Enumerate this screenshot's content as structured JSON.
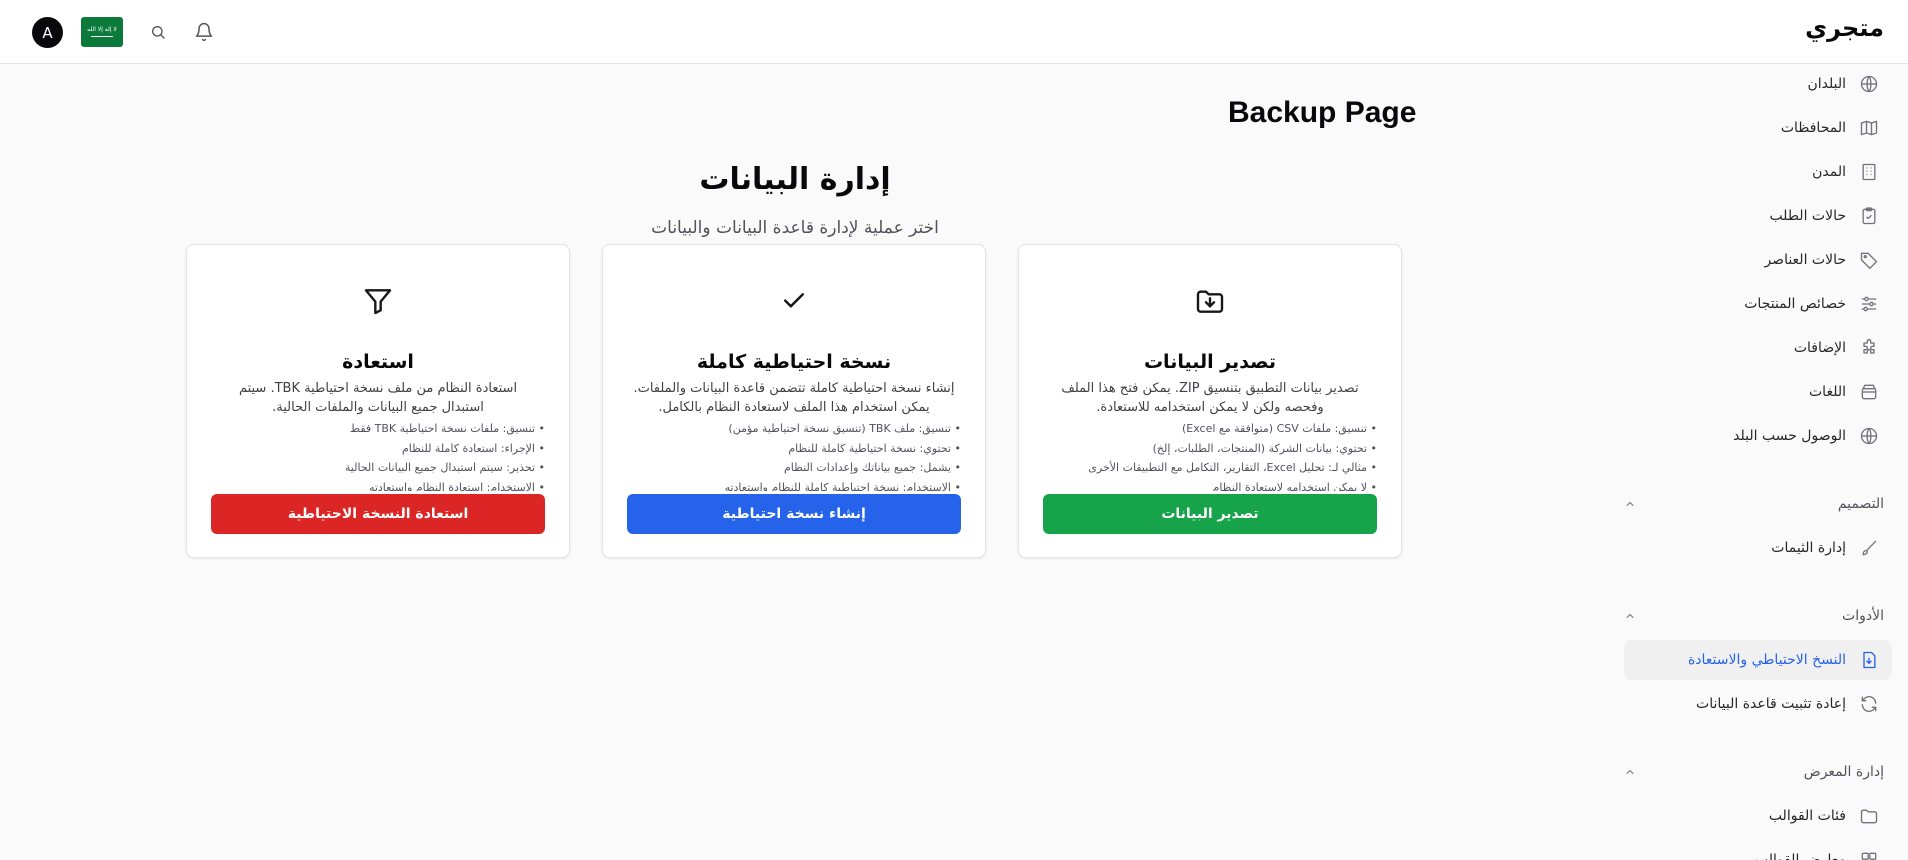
{
  "header": {
    "brand": "متجري",
    "avatar_initial": "A",
    "flag_script": "لا إله إلا الله",
    "icons": [
      "bell-icon",
      "search-icon"
    ]
  },
  "page": {
    "title": "Backup Page",
    "section_title": "إدارة البيانات",
    "section_subtitle": "اختر عملية لإدارة قاعدة البيانات والبيانات"
  },
  "cards": [
    {
      "icon": "folder-download-icon",
      "title": "تصدير البيانات",
      "description": "تصدير بيانات التطبيق بتنسيق ZIP. يمكن فتح هذا الملف وفحصه ولكن لا يمكن استخدامه للاستعادة.",
      "bullets": [
        "تنسيق: ملفات CSV (متوافقة مع Excel)",
        "تحتوي: بيانات الشركة (المنتجات، الطلبات، إلخ)",
        "مثالي لـ: تحليل Excel، التقارير، التكامل مع التطبيقات الأخرى",
        "لا يمكن استخدامه لاستعادة النظام"
      ],
      "button": "تصدير البيانات",
      "color": "#16a34a"
    },
    {
      "icon": "check-icon",
      "title": "نسخة احتياطية كاملة",
      "description": "إنشاء نسخة احتياطية كاملة تتضمن قاعدة البيانات والملفات. يمكن استخدام هذا الملف لاستعادة النظام بالكامل.",
      "bullets": [
        "تنسيق: ملف TBK (تنسيق نسخة احتياطية مؤمن)",
        "تحتوي: نسخة احتياطية كاملة للنظام",
        "يشمل: جميع بياناتك وإعدادات النظام",
        "الاستخدام: نسخة احتياطية كاملة للنظام واستعادته"
      ],
      "button": "إنشاء نسخة احتياطية",
      "color": "#2563eb"
    },
    {
      "icon": "filter-icon",
      "title": "استعادة",
      "description": "استعادة النظام من ملف نسخة احتياطية TBK. سيتم استبدال جميع البيانات والملفات الحالية.",
      "bullets": [
        "تنسيق: ملفات نسخة احتياطية TBK فقط",
        "الإجراء: استعادة كاملة للنظام",
        "تحذير: سيتم استبدال جميع البيانات الحالية",
        "الاستخدام: استعادة النظام واستعادته"
      ],
      "button": "استعادة النسخة الاحتياطية",
      "color": "#dc2626"
    }
  ],
  "sidebar": {
    "items": [
      {
        "label": "البلدان",
        "icon": "globe-icon"
      },
      {
        "label": "المحافظات",
        "icon": "map-icon"
      },
      {
        "label": "المدن",
        "icon": "building-icon"
      },
      {
        "label": "حالات الطلب",
        "icon": "clipboard-check-icon"
      },
      {
        "label": "حالات العناصر",
        "icon": "tag-icon"
      },
      {
        "label": "خصائص المنتجات",
        "icon": "sliders-icon"
      },
      {
        "label": "الإضافات",
        "icon": "puzzle-icon"
      },
      {
        "label": "اللغات",
        "icon": "archive-icon"
      },
      {
        "label": "الوصول حسب البلد",
        "icon": "globe-icon"
      }
    ],
    "design_group": "التصميم",
    "design_items": [
      {
        "label": "إدارة الثيمات",
        "icon": "brush-icon"
      }
    ],
    "tools_group": "الأدوات",
    "tools_items": [
      {
        "label": "النسخ الاحتياطي والاستعادة",
        "icon": "file-download-icon",
        "active": true
      },
      {
        "label": "إعادة تثبيت قاعدة البيانات",
        "icon": "refresh-icon"
      }
    ],
    "gallery_group": "إدارة المعرض",
    "gallery_items": [
      {
        "label": "فئات القوالب",
        "icon": "folder-icon"
      },
      {
        "label": "معارض القوالب",
        "icon": "grid-icon"
      }
    ]
  },
  "colors": {
    "accent": "#2563eb",
    "success": "#16a34a",
    "danger": "#dc2626"
  }
}
